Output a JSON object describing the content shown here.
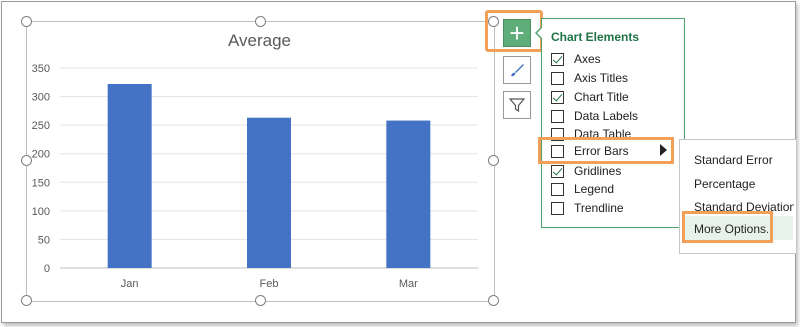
{
  "chart": {
    "title": "Average"
  },
  "chart_data": {
    "type": "bar",
    "title": "Average",
    "categories": [
      "Jan",
      "Feb",
      "Mar"
    ],
    "values": [
      322,
      263,
      258
    ],
    "ylim": [
      0,
      350
    ],
    "yticks": [
      0,
      50,
      100,
      150,
      200,
      250,
      300,
      350
    ],
    "grid": true,
    "bar_color": "#4472c4"
  },
  "side_buttons": [
    {
      "icon": "plus-icon",
      "label": "+"
    },
    {
      "icon": "brush-icon"
    },
    {
      "icon": "filter-icon"
    }
  ],
  "panel": {
    "title": "Chart Elements",
    "items": [
      {
        "label": "Axes",
        "checked": true
      },
      {
        "label": "Axis Titles",
        "checked": false
      },
      {
        "label": "Chart Title",
        "checked": true
      },
      {
        "label": "Data Labels",
        "checked": false
      },
      {
        "label": "Data Table",
        "checked": false
      },
      {
        "label": "Error Bars",
        "checked": false
      },
      {
        "label": "Gridlines",
        "checked": true
      },
      {
        "label": "Legend",
        "checked": false
      },
      {
        "label": "Trendline",
        "checked": false
      }
    ]
  },
  "submenu": {
    "items": [
      "Standard Error",
      "Percentage",
      "Standard Deviation",
      "More Options..."
    ]
  },
  "colors": {
    "accent_green": "#217346",
    "highlight_orange": "#f2a057",
    "bar_blue": "#4472c4"
  }
}
